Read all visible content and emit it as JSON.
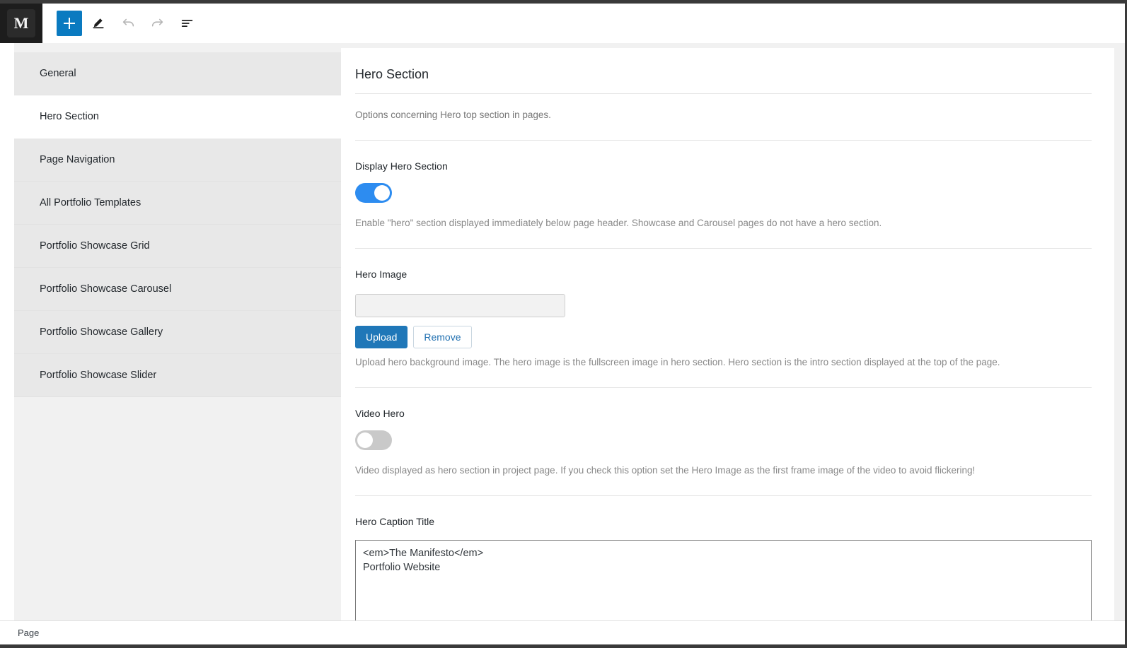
{
  "adminbar": {
    "logo_letter": "M",
    "tools": [
      {
        "name": "add-block-button",
        "icon": "plus-icon",
        "label": "+"
      },
      {
        "name": "edit-pencil-button",
        "icon": "pencil-icon",
        "label": ""
      },
      {
        "name": "undo-button",
        "icon": "undo-arrow-icon",
        "label": ""
      },
      {
        "name": "redo-button",
        "icon": "redo-arrow-icon",
        "label": ""
      },
      {
        "name": "details-button",
        "icon": "list-details-icon",
        "label": ""
      }
    ]
  },
  "sidebar": {
    "items": [
      {
        "label": "General",
        "active": false
      },
      {
        "label": "Hero Section",
        "active": true
      },
      {
        "label": "Page Navigation",
        "active": false
      },
      {
        "label": "All Portfolio Templates",
        "active": false
      },
      {
        "label": "Portfolio Showcase Grid",
        "active": false
      },
      {
        "label": "Portfolio Showcase Carousel",
        "active": false
      },
      {
        "label": "Portfolio Showcase Gallery",
        "active": false
      },
      {
        "label": "Portfolio Showcase Slider",
        "active": false
      }
    ]
  },
  "main": {
    "title": "Hero Section",
    "description": "Options concerning Hero top section in pages.",
    "display_hero": {
      "label": "Display Hero Section",
      "toggle_state": "on",
      "help": "Enable \"hero\" section displayed immediately below page header. Showcase and Carousel pages do not have a hero section."
    },
    "hero_image": {
      "label": "Hero Image",
      "value": "",
      "placeholder": "",
      "upload_label": "Upload",
      "remove_label": "Remove",
      "help": "Upload hero background image. The hero image is the fullscreen image in hero section. Hero section is the intro section displayed at the top of the page."
    },
    "video_hero": {
      "label": "Video Hero",
      "toggle_state": "off",
      "help": "Video displayed as hero section in project page. If you check this option set the Hero Image as the first frame image of the video to avoid flickering!"
    },
    "hero_caption_title": {
      "label": "Hero Caption Title",
      "value": "<em>The Manifesto</em>\nPortfolio Website"
    }
  },
  "statusbar": {
    "text": "Page"
  },
  "colors": {
    "accent_blue": "#0a7ac0",
    "toggle_on": "#2d8cf0",
    "toggle_off": "#c9c9c9",
    "button_primary": "#1f77b8",
    "link_blue": "#2271b1"
  }
}
